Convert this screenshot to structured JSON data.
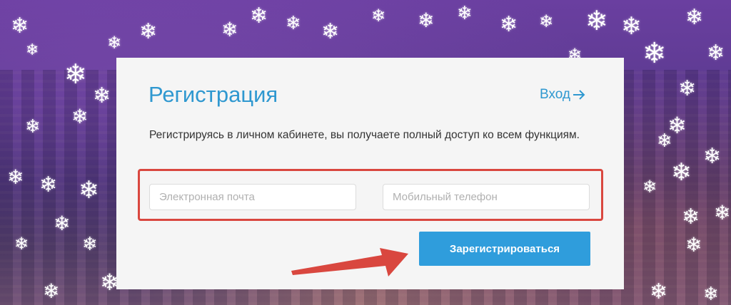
{
  "form": {
    "title": "Регистрация",
    "login_label": "Вход",
    "description": "Регистрируясь в личном кабинете, вы получаете полный доступ ко всем функциям.",
    "email_placeholder": "Электронная почта",
    "phone_placeholder": "Мобильный телефон",
    "submit_label": "Зарегистрироваться"
  },
  "colors": {
    "accent": "#2f98d0",
    "button": "#2f9ddc",
    "annotation": "#d9473f",
    "card": "#f5f5f5"
  },
  "icons": {
    "login_arrow": "arrow-right-icon",
    "decoration": "snowflake-icon"
  }
}
